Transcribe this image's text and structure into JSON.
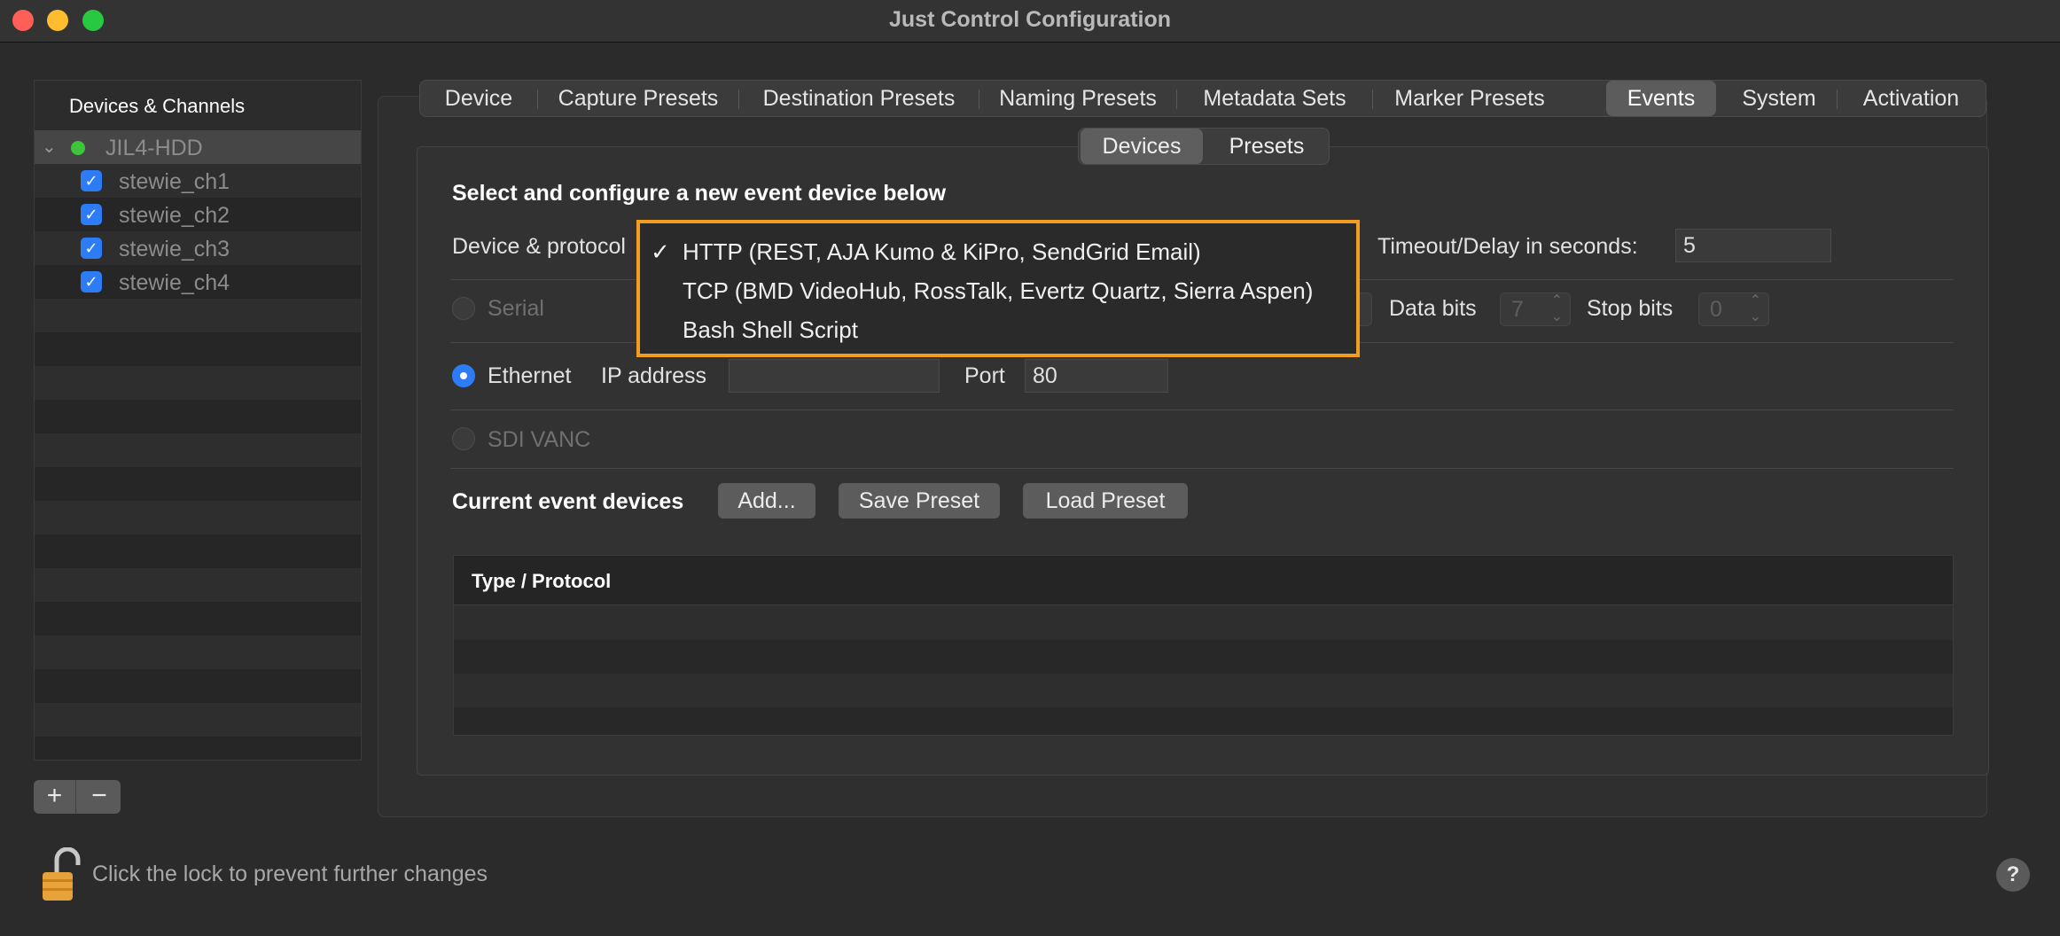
{
  "window": {
    "title": "Just Control Configuration"
  },
  "sidebar": {
    "header": "Devices & Channels",
    "device": {
      "label": "JIL4-HDD",
      "status_color": "#3ec43b"
    },
    "channels": [
      {
        "label": "stewie_ch1",
        "checked": true
      },
      {
        "label": "stewie_ch2",
        "checked": true
      },
      {
        "label": "stewie_ch3",
        "checked": true
      },
      {
        "label": "stewie_ch4",
        "checked": true
      }
    ],
    "add_label": "+",
    "remove_label": "−"
  },
  "tabs": [
    {
      "label": "Device"
    },
    {
      "label": "Capture Presets"
    },
    {
      "label": "Destination Presets"
    },
    {
      "label": "Naming Presets"
    },
    {
      "label": "Metadata Sets"
    },
    {
      "label": "Marker Presets"
    },
    {
      "label": "Events",
      "active": true
    },
    {
      "label": "System"
    },
    {
      "label": "Activation"
    }
  ],
  "subtabs": [
    {
      "label": "Devices",
      "active": true
    },
    {
      "label": "Presets"
    }
  ],
  "form": {
    "heading": "Select and configure a new event device below",
    "device_protocol_label": "Device & protocol",
    "timeout_label": "Timeout/Delay in seconds:",
    "timeout_value": "5",
    "serial_label": "Serial",
    "data_bits_label": "Data bits",
    "data_bits_value": "7",
    "stop_bits_label": "Stop bits",
    "stop_bits_value": "0",
    "ethernet_label": "Ethernet",
    "ip_label": "IP address",
    "ip_value": "",
    "port_label": "Port",
    "port_value": "80",
    "sdi_label": "SDI VANC",
    "selected_connection": "Ethernet"
  },
  "devices_section": {
    "title": "Current event devices",
    "add_button": "Add...",
    "save_button": "Save Preset",
    "load_button": "Load Preset",
    "table_header": "Type / Protocol"
  },
  "dropdown": {
    "items": [
      {
        "label": "HTTP (REST, AJA Kumo & KiPro, SendGrid Email)",
        "checked": true,
        "check_mark": "✓"
      },
      {
        "label": "TCP (BMD VideoHub, RossTalk, Evertz Quartz, Sierra Aspen)",
        "checked": false
      },
      {
        "label": "Bash Shell Script",
        "checked": false
      }
    ],
    "highlight_color": "#f39c1d"
  },
  "footer": {
    "lock_text": "Click the lock to prevent further changes",
    "help_label": "?"
  },
  "colors": {
    "accent": "#2d7cf6",
    "window_bg": "#2b2b2b"
  }
}
